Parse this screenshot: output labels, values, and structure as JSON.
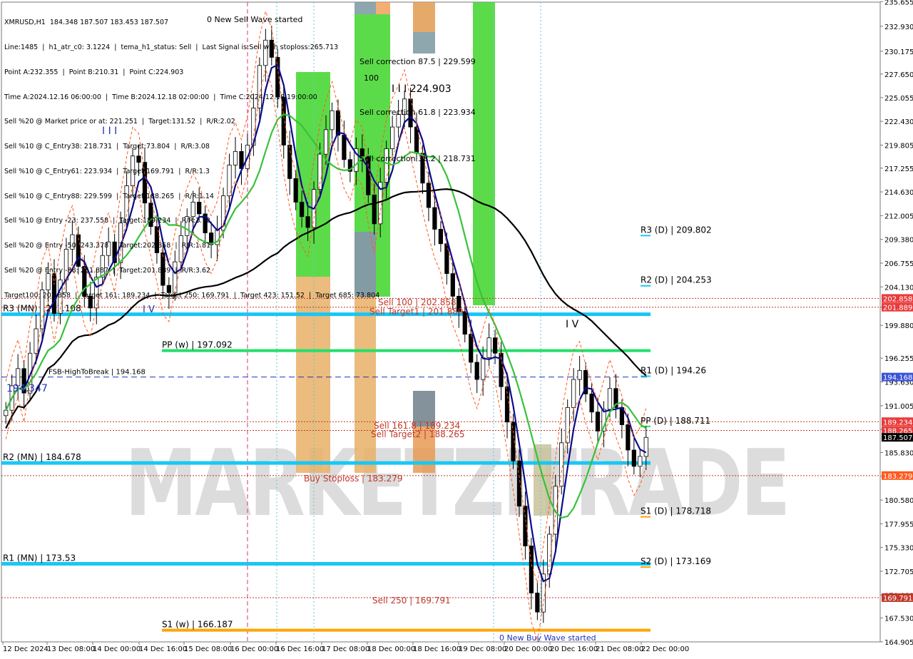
{
  "chart_data": {
    "type": "candlestick",
    "symbol_header": "XMRUSD,H1  184.348 187.507 183.453 187.507",
    "info_lines": [
      "Line:1485  |  h1_atr_c0: 3.1224  |  tema_h1_status: Sell  |  Last Signal is:Sell with stoploss:265.713",
      "Point A:232.355  |  Point B:210.31  |  Point C:224.903",
      "Time A:2024.12.16 06:00:00  |  Time B:2024.12.18 02:00:00  |  Time C:2024.12.18 19:00:00",
      "Sell %20 @ Market price or at: 221.251  |  Target:131.52  |  R/R:2.02",
      "Sell %10 @ C_Entry38: 218.731  |  Target:73.804  |  R/R:3.08",
      "Sell %10 @ C_Entry61: 223.934  |  Target:169.791  |  R/R:1.3",
      "Sell %10 @ C_Entry88: 229.599  |  Target:188.265  |  R/R:1.14",
      "Sell %10 @ Entry -23: 237.558  |  Target:189.234  |  R/R:1.72",
      "Sell %20 @ Entry -50: 243.378  |  Target:202.858  |  R/R:1.81",
      "Sell %20 @ Entry -88: 251.887  |  Target:201.889  |  R/R:3.62",
      "Target100: 202.858  |  Target 161: 189.234  |  Target 250: 169.791  |  Target 423: 151.52  |  Target 685: 73.804"
    ],
    "watermark": "MARKETZITRADE",
    "ylim": [
      164.9,
      235.6
    ],
    "y_ticks": [
      "235.655",
      "232.930",
      "230.175",
      "227.650",
      "225.055",
      "222.430",
      "219.805",
      "217.255",
      "214.630",
      "212.005",
      "209.380",
      "206.755",
      "204.130",
      "201.889",
      "199.880",
      "196.255",
      "193.630",
      "191.005",
      "188.380",
      "185.830",
      "183.205",
      "180.580",
      "177.955",
      "175.330",
      "172.705",
      "170.080",
      "167.530",
      "164.905"
    ],
    "x_labels": [
      "12 Dec 2024",
      "13 Dec 08:00",
      "14 Dec 00:00",
      "14 Dec 16:00",
      "15 Dec 08:00",
      "16 Dec 00:00",
      "16 Dec 16:00",
      "17 Dec 08:00",
      "18 Dec 00:00",
      "18 Dec 16:00",
      "19 Dec 08:00",
      "20 Dec 00:00",
      "20 Dec 16:00",
      "21 Dec 08:00",
      "22 Dec 00:00"
    ],
    "price_flags": [
      {
        "label": "202.858",
        "color": "#e83b3b",
        "value": 202.858
      },
      {
        "label": "201.889",
        "color": "#e83b3b",
        "value": 201.889
      },
      {
        "label": "194.168",
        "color": "#3a53d8",
        "value": 194.168
      },
      {
        "label": "189.234",
        "color": "#e83b3b",
        "value": 189.234
      },
      {
        "label": "188.265",
        "color": "#e83b3b",
        "value": 188.265
      },
      {
        "label": "187.507",
        "color": "#000000",
        "value": 187.507
      },
      {
        "label": "183.279",
        "color": "#ff5a1e",
        "value": 183.279
      },
      {
        "label": "169.791",
        "color": "#c0392b",
        "value": 169.791
      }
    ],
    "horizontal_levels": [
      {
        "label": "R3 (MN) | 201.108",
        "value": 201.108,
        "color": "#18c7f5",
        "style": "solid",
        "width": 5
      },
      {
        "label": "PP (w) | 197.092",
        "value": 197.092,
        "color": "#22e06a",
        "style": "solid",
        "width": 4
      },
      {
        "label": "FSB-HighToBreak | 194.168",
        "value": 194.168,
        "color": "#2333b8",
        "style": "dashed",
        "width": 1
      },
      {
        "label": "R2 (MN) | 184.678",
        "value": 184.678,
        "color": "#18c7f5",
        "style": "solid",
        "width": 5
      },
      {
        "label": "R1 (MN) | 173.53",
        "value": 173.53,
        "color": "#18c7f5",
        "style": "solid",
        "width": 5
      },
      {
        "label": "S1 (w) | 166.187",
        "value": 166.187,
        "color": "#ffa500",
        "style": "solid",
        "width": 4
      }
    ],
    "dotted_red_levels": [
      {
        "value": 202.858
      },
      {
        "value": 201.889
      },
      {
        "value": 189.234
      },
      {
        "value": 188.265
      },
      {
        "value": 183.279
      },
      {
        "value": 169.791
      }
    ],
    "daily_pivots": [
      {
        "label": "R3 (D) | 209.802",
        "value": 209.802,
        "color": "#18c7f5"
      },
      {
        "label": "R2 (D) | 204.253",
        "value": 204.253,
        "color": "#18c7f5"
      },
      {
        "label": "R1 (D) | 194.26",
        "value": 194.26,
        "color": "#18c7f5"
      },
      {
        "label": "PP (D) | 188.711",
        "value": 188.711,
        "color": "#22e06a"
      },
      {
        "label": "S1 (D) | 178.718",
        "value": 178.718,
        "color": "#ffa500"
      },
      {
        "label": "S2 (D) | 173.169",
        "value": 173.169,
        "color": "#ffa500"
      }
    ],
    "annotations": [
      {
        "text": "0 New Sell Wave started",
        "color": "#000000"
      },
      {
        "text": "Sell correction 87.5 | 229.599",
        "color": "#000000"
      },
      {
        "text": "100",
        "color": "#000000"
      },
      {
        "text": "I I I 224.903",
        "color": "#000000"
      },
      {
        "text": "Sell correction 61.8 | 223.934",
        "color": "#000000"
      },
      {
        "text": "Sell correction 38.2 | 218.731",
        "color": "#000000"
      },
      {
        "text": "I I I",
        "color": "#2333b8"
      },
      {
        "text": "I V",
        "color": "#2333b8"
      },
      {
        "text": "I V",
        "color": "#000000"
      },
      {
        "text": "194.347",
        "color": "#2333b8"
      },
      {
        "text": "Sell 100 | 202.858",
        "color": "#c0392b"
      },
      {
        "text": "Sell Target1 | 201.889",
        "color": "#c0392b"
      },
      {
        "text": "Sell 161.8 | 189.234",
        "color": "#c0392b"
      },
      {
        "text": "Sell Target2 | 188.265",
        "color": "#c0392b"
      },
      {
        "text": "Buy Stoploss | 183.279",
        "color": "#c0392b"
      },
      {
        "text": "Sell 250 | 169.791",
        "color": "#c0392b"
      },
      {
        "text": "0 New Buy Wave started",
        "color": "#2333b8"
      }
    ],
    "close_series": [
      190.5,
      193.2,
      195.1,
      192.4,
      196.8,
      199.5,
      203.8,
      205.6,
      201.2,
      204.9,
      208.3,
      209.9,
      206.4,
      203.1,
      201.8,
      205.2,
      207.6,
      209.1,
      206.8,
      211.2,
      215.3,
      218.6,
      217.9,
      213.4,
      210.8,
      207.9,
      204.3,
      203.5,
      206.9,
      209.8,
      211.9,
      213.5,
      212.2,
      210.1,
      208.8,
      210.4,
      214.2,
      217.6,
      219.1,
      217.2,
      219.8,
      223.9,
      228.6,
      231.4,
      229.5,
      225.1,
      219.8,
      216.1,
      213.5,
      211.9,
      210.7,
      214.9,
      218.8,
      221.5,
      223.6,
      220.9,
      218.2,
      216.9,
      219.4,
      218.6,
      214.3,
      211.1,
      215.7,
      219.4,
      221.8,
      223.2,
      224.9,
      221.8,
      218.9,
      215.6,
      212.9,
      210.5,
      208.9,
      205.6,
      203.1,
      201.4,
      198.9,
      195.8,
      193.9,
      196.3,
      198.5,
      196.8,
      193.1,
      189.2,
      184.9,
      179.9,
      175.5,
      170.3,
      168.2,
      172.4,
      176.8,
      182.1,
      186.9,
      190.8,
      193.9,
      194.9,
      192.3,
      190.3,
      188.2,
      190.6,
      192.9,
      190.8,
      188.9,
      186.1,
      184.3,
      185.4,
      187.5
    ]
  }
}
